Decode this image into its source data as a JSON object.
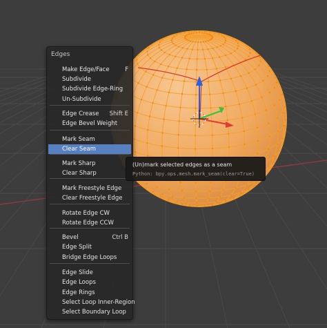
{
  "colors": {
    "background": "#3d3d3d",
    "sphere_fill": "#f2ae6a",
    "wire": "#f5a030",
    "menu_bg": "#282828",
    "highlight": "#5680c2",
    "axis_x": "#e23a3a",
    "axis_y": "#36c23a",
    "axis_z": "#2a5fe0"
  },
  "menu": {
    "title": "Edges",
    "items": [
      {
        "label": "Make Edge/Face",
        "shortcut": "F"
      },
      {
        "label": "Subdivide",
        "shortcut": ""
      },
      {
        "label": "Subdivide Edge-Ring",
        "shortcut": ""
      },
      {
        "label": "Un-Subdivide",
        "shortcut": ""
      },
      {
        "label": "Edge Crease",
        "shortcut": "Shift E"
      },
      {
        "label": "Edge Bevel Weight",
        "shortcut": ""
      },
      {
        "label": "Mark Seam",
        "shortcut": ""
      },
      {
        "label": "Clear Seam",
        "shortcut": "",
        "active": true
      },
      {
        "label": "Mark Sharp",
        "shortcut": ""
      },
      {
        "label": "Clear Sharp",
        "shortcut": ""
      },
      {
        "label": "Mark Freestyle Edge",
        "shortcut": ""
      },
      {
        "label": "Clear Freestyle Edge",
        "shortcut": ""
      },
      {
        "label": "Rotate Edge CW",
        "shortcut": ""
      },
      {
        "label": "Rotate Edge CCW",
        "shortcut": ""
      },
      {
        "label": "Bevel",
        "shortcut": "Ctrl B"
      },
      {
        "label": "Edge Split",
        "shortcut": ""
      },
      {
        "label": "Bridge Edge Loops",
        "shortcut": ""
      },
      {
        "label": "Edge Slide",
        "shortcut": ""
      },
      {
        "label": "Edge Loops",
        "shortcut": ""
      },
      {
        "label": "Edge Rings",
        "shortcut": ""
      },
      {
        "label": "Select Loop Inner-Region",
        "shortcut": ""
      },
      {
        "label": "Select Boundary Loop",
        "shortcut": ""
      }
    ]
  },
  "tooltip": {
    "title": "(Un)mark selected edges as a seam",
    "python": "Python: bpy.ops.mesh.mark_seam(clear=True)"
  }
}
